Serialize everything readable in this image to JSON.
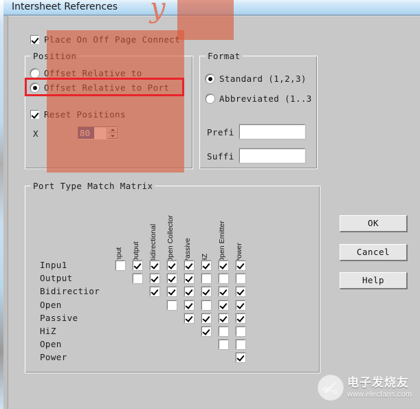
{
  "window": {
    "title": "Intersheet References"
  },
  "annotations": {
    "cursive_mark": "y"
  },
  "place_on_off_page_connect": {
    "label": "Place On Off Page Connect",
    "checked": true
  },
  "position_group": {
    "legend": "Position",
    "radios": [
      {
        "label": "Offset Relative to",
        "selected": false
      },
      {
        "label": "Offset Relative to Port",
        "selected": true,
        "highlighted": true
      }
    ],
    "reset_positions": {
      "label": "Reset Positions",
      "checked": true
    },
    "x_field": {
      "label": "X",
      "value": "80"
    }
  },
  "format_group": {
    "legend": "Format",
    "radios": [
      {
        "label": "Standard (1,2,3)",
        "selected": true
      },
      {
        "label": "Abbreviated (1..3",
        "selected": false
      }
    ],
    "prefix": {
      "label": "Prefi",
      "value": "",
      "placeholder": ""
    },
    "suffix": {
      "label": "Suffi",
      "value": "",
      "placeholder": ""
    }
  },
  "matrix_group": {
    "legend": "Port Type Match Matrix",
    "columns": [
      "Input",
      "Output",
      "Bidirectional",
      "Open Collector",
      "Passive",
      "HZ",
      "Open Emitter",
      "Power"
    ],
    "rows": [
      {
        "label": "Inpu1",
        "start": 0,
        "cells": [
          false,
          true,
          true,
          true,
          true,
          true,
          true,
          true
        ]
      },
      {
        "label": "Output",
        "start": 1,
        "cells": [
          false,
          true,
          true,
          true,
          false,
          false,
          false
        ]
      },
      {
        "label": "Bidirectior",
        "start": 2,
        "cells": [
          true,
          true,
          true,
          true,
          true,
          true
        ]
      },
      {
        "label": "Open",
        "start": 3,
        "cells": [
          false,
          true,
          false,
          true,
          true
        ]
      },
      {
        "label": "Passive",
        "start": 4,
        "cells": [
          true,
          true,
          true,
          true
        ]
      },
      {
        "label": "HiZ",
        "start": 5,
        "cells": [
          true,
          false,
          false
        ]
      },
      {
        "label": "Open",
        "start": 6,
        "cells": [
          false,
          false
        ]
      },
      {
        "label": "Power",
        "start": 7,
        "cells": [
          true
        ]
      }
    ]
  },
  "buttons": {
    "ok": "OK",
    "cancel": "Cancel",
    "help": "Help"
  },
  "watermark": {
    "cn": "电子发烧友",
    "url": "www.elecfans.com"
  }
}
